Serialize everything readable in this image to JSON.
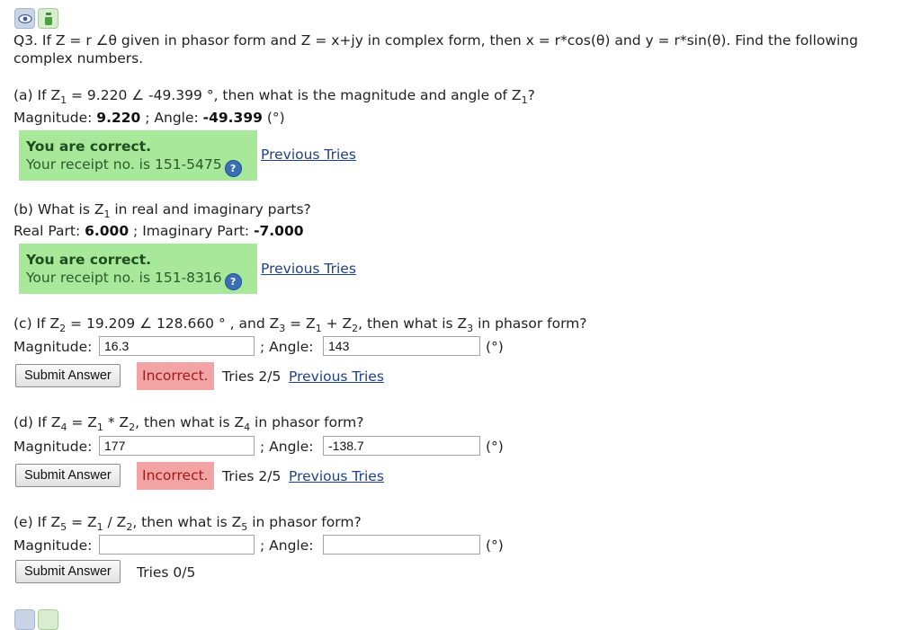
{
  "question": {
    "line1": "Q3. If Z = r ∠θ given in phasor form and Z = x+jy in complex form, then x = r*cos(θ) and y = r*sin(θ). Find the following",
    "line2": "complex numbers."
  },
  "part_a": {
    "prompt_start": "(a) If Z",
    "sub1": "1",
    "prompt_mid": " = 9.220 ∠ -49.399 °, then what is the magnitude and angle of Z",
    "sub2": "1",
    "prompt_end": "?",
    "mag_label": "Magnitude: ",
    "mag_value": "9.220",
    "sep": " ; Angle: ",
    "angle_value": "-49.399",
    "unit": " (°)",
    "correct": "You are correct.",
    "receipt": "Your receipt no. is 151-5475",
    "prev_tries": "Previous Tries"
  },
  "part_b": {
    "prompt_start": "(b) What is Z",
    "sub1": "1",
    "prompt_end": " in real and imaginary parts?",
    "real_label": "Real Part: ",
    "real_value": "6.000",
    "sep": " ; Imaginary Part: ",
    "imag_value": "-7.000",
    "correct": "You are correct.",
    "receipt": "Your receipt no. is 151-8316",
    "prev_tries": "Previous Tries"
  },
  "part_c": {
    "p1": "(c) If Z",
    "s1": "2",
    "p2": " = 19.209 ∠ 128.660 ° , and Z",
    "s2": "3",
    "p3": " = Z",
    "s3": "1",
    "p4": " + Z",
    "s4": "2",
    "p5": ", then what is Z",
    "s5": "3",
    "p6": " in phasor form?",
    "mag_label": "Magnitude:",
    "mag_value": "16.3",
    "angle_label": "; Angle:",
    "angle_value": "143",
    "unit": "(°)",
    "submit": "Submit Answer",
    "status": "Incorrect.",
    "tries": "Tries 2/5",
    "prev_tries": "Previous Tries"
  },
  "part_d": {
    "p1": "(d) If Z",
    "s1": "4",
    "p2": " = Z",
    "s2": "1",
    "p3": " * Z",
    "s3": "2",
    "p4": ", then what is Z",
    "s4": "4",
    "p5": " in phasor form?",
    "mag_label": "Magnitude:",
    "mag_value": "177",
    "angle_label": "; Angle:",
    "angle_value": "-138.7",
    "unit": "(°)",
    "submit": "Submit Answer",
    "status": "Incorrect.",
    "tries": "Tries 2/5",
    "prev_tries": "Previous Tries"
  },
  "part_e": {
    "p1": "(e) If Z",
    "s1": "5",
    "p2": " = Z",
    "s2": "1",
    "p3": " / Z",
    "s3": "2",
    "p4": ", then what is Z",
    "s4": "5",
    "p5": " in phasor form?",
    "mag_label": "Magnitude:",
    "mag_value": "",
    "angle_label": "; Angle:",
    "angle_value": "",
    "unit": "(°)",
    "submit": "Submit Answer",
    "tries": "Tries 0/5"
  },
  "icons": {
    "eye": "eye-icon",
    "hint": "hint-icon",
    "help": "help-icon"
  },
  "colors": {
    "correct_bg": "#a8e89a",
    "incorrect_bg": "#f2a3a3",
    "link": "#1f3f8f"
  }
}
